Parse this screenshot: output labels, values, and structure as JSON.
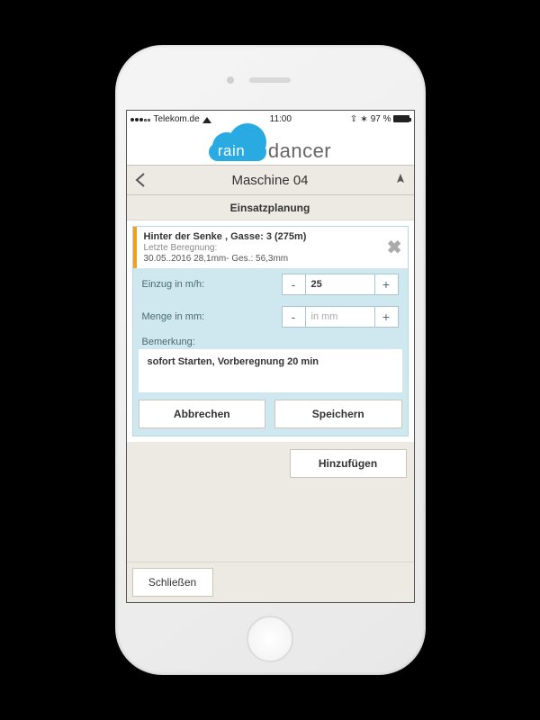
{
  "status": {
    "carrier": "Telekom.de",
    "time": "11:00",
    "battery": "97 %"
  },
  "logo": {
    "cloud": "rain",
    "rest": "dancer"
  },
  "nav": {
    "title": "Maschine 04"
  },
  "section": {
    "title": "Einsatzplanung"
  },
  "item": {
    "title": "Hinter der Senke , Gasse: 3 (275m)",
    "last_label": "Letzte Beregnung:",
    "dateline": "30.05..2016 28,1mm-   Ges.:   56,3mm"
  },
  "form": {
    "einzug_label": "Einzug in m/h:",
    "einzug_value": "25",
    "menge_label": "Menge in mm:",
    "menge_placeholder": "in mm",
    "remark_label": "Bemerkung:",
    "remark_value": "sofort Starten, Vorberegnung 20 min",
    "minus": "-",
    "plus": "+"
  },
  "buttons": {
    "cancel": "Abbrechen",
    "save": "Speichern",
    "add": "Hinzufügen",
    "close": "Schließen"
  }
}
